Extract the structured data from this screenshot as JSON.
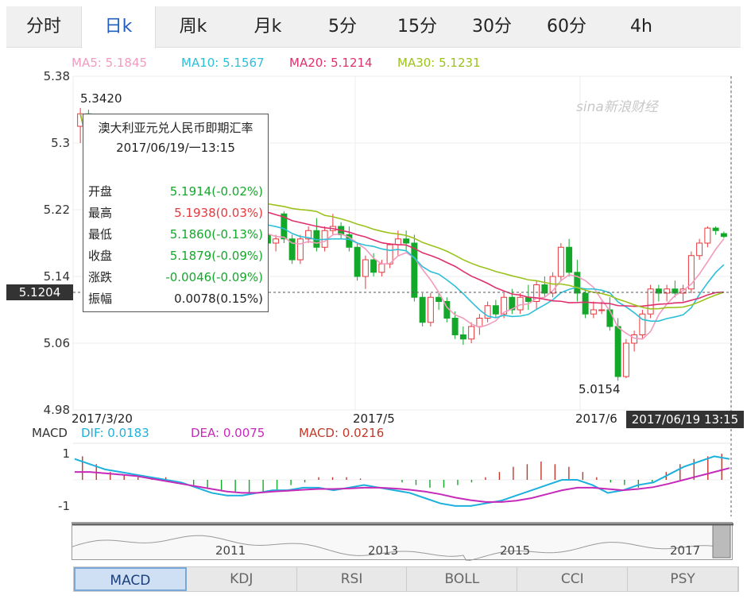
{
  "tabs": [
    "分时",
    "日k",
    "周k",
    "月k",
    "5分",
    "15分",
    "30分",
    "60分",
    "4h"
  ],
  "active_tab": 1,
  "ma_legend": {
    "ma5": "MA5: 5.1845",
    "ma10": "MA10: 5.1567",
    "ma20": "MA20: 5.1214",
    "ma30": "MA30: 5.1231"
  },
  "colors": {
    "up": "#e8383d",
    "down": "#14a82a",
    "ma5": "#f29bbf",
    "ma10": "#2ebfd8",
    "ma20": "#e0306e",
    "ma30": "#9bc21c",
    "dif": "#1cb0dd",
    "dea": "#c52ab9",
    "macd_bar": "#c0392b"
  },
  "watermark": "sina新浪财经",
  "price_axis_ticks": [
    "5.38",
    "5.3",
    "5.22",
    "5.14",
    "5.06",
    "4.98"
  ],
  "date_labels": [
    "2017/3/20",
    "2017/5",
    "2017/6"
  ],
  "annotations": {
    "high": "5.3420",
    "low": "5.0154"
  },
  "crosshair": {
    "price_label": "5.1204",
    "date_label": "2017/06/19 13:15"
  },
  "tooltip": {
    "title": "澳大利亚元兑人民币即期汇率",
    "date": "2017/06/19/一13:15",
    "rows": [
      {
        "label": "开盘",
        "value": "5.1914(-0.02%)",
        "color": "down"
      },
      {
        "label": "最高",
        "value": "5.1938(0.03%)",
        "color": "up"
      },
      {
        "label": "最低",
        "value": "5.1860(-0.13%)",
        "color": "down"
      },
      {
        "label": "收盘",
        "value": "5.1879(-0.09%)",
        "color": "down"
      },
      {
        "label": "涨跌",
        "value": "-0.0046(-0.09%)",
        "color": "down"
      },
      {
        "label": "振幅",
        "value": "0.0078(0.15%)",
        "color": "neutral"
      }
    ]
  },
  "macd_legend": {
    "name": "MACD",
    "dif": "DIF: 0.0183",
    "dea": "DEA: 0.0075",
    "macd": "MACD: 0.0216"
  },
  "macd_axis_ticks": [
    "1",
    "-1"
  ],
  "navigator_years": [
    "2011",
    "2013",
    "2015",
    "2017"
  ],
  "indicator_tabs": [
    "MACD",
    "KDJ",
    "RSI",
    "BOLL",
    "CCI",
    "PSY"
  ],
  "active_indicator": 0,
  "chart_data": {
    "type": "candlestick",
    "ylim": [
      4.98,
      5.38
    ],
    "candles": [
      [
        5.32,
        5.342,
        5.3,
        5.335
      ],
      [
        5.335,
        5.34,
        5.24,
        5.25
      ],
      [
        5.25,
        5.27,
        5.245,
        5.265
      ],
      [
        5.265,
        5.275,
        5.25,
        5.26
      ],
      [
        5.26,
        5.265,
        5.235,
        5.245
      ],
      [
        5.245,
        5.25,
        5.225,
        5.24
      ],
      [
        5.24,
        5.25,
        5.232,
        5.248
      ],
      [
        5.248,
        5.252,
        5.225,
        5.23
      ],
      [
        5.23,
        5.245,
        5.225,
        5.24
      ],
      [
        5.24,
        5.245,
        5.215,
        5.22
      ],
      [
        5.22,
        5.235,
        5.21,
        5.23
      ],
      [
        5.23,
        5.235,
        5.215,
        5.22
      ],
      [
        5.22,
        5.238,
        5.215,
        5.232
      ],
      [
        5.232,
        5.24,
        5.215,
        5.218
      ],
      [
        5.218,
        5.225,
        5.2,
        5.205
      ],
      [
        5.205,
        5.215,
        5.195,
        5.21
      ],
      [
        5.21,
        5.222,
        5.205,
        5.218
      ],
      [
        5.218,
        5.226,
        5.21,
        5.222
      ],
      [
        5.222,
        5.228,
        5.205,
        5.208
      ],
      [
        5.208,
        5.215,
        5.195,
        5.2
      ],
      [
        5.2,
        5.208,
        5.185,
        5.19
      ],
      [
        5.19,
        5.2,
        5.18,
        5.195
      ],
      [
        5.195,
        5.205,
        5.185,
        5.19
      ],
      [
        5.19,
        5.198,
        5.175,
        5.18
      ],
      [
        5.18,
        5.19,
        5.17,
        5.185
      ],
      [
        5.215,
        5.218,
        5.18,
        5.185
      ],
      [
        5.185,
        5.19,
        5.155,
        5.16
      ],
      [
        5.16,
        5.19,
        5.155,
        5.185
      ],
      [
        5.185,
        5.2,
        5.18,
        5.195
      ],
      [
        5.195,
        5.21,
        5.17,
        5.175
      ],
      [
        5.175,
        5.2,
        5.17,
        5.195
      ],
      [
        5.195,
        5.215,
        5.19,
        5.2
      ],
      [
        5.2,
        5.205,
        5.185,
        5.19
      ],
      [
        5.19,
        5.2,
        5.17,
        5.175
      ],
      [
        5.175,
        5.18,
        5.135,
        5.14
      ],
      [
        5.14,
        5.165,
        5.125,
        5.16
      ],
      [
        5.16,
        5.168,
        5.14,
        5.145
      ],
      [
        5.145,
        5.16,
        5.14,
        5.155
      ],
      [
        5.155,
        5.18,
        5.15,
        5.178
      ],
      [
        5.178,
        5.195,
        5.165,
        5.185
      ],
      [
        5.185,
        5.195,
        5.17,
        5.18
      ],
      [
        5.18,
        5.19,
        5.11,
        5.115
      ],
      [
        5.115,
        5.12,
        5.08,
        5.085
      ],
      [
        5.085,
        5.12,
        5.08,
        5.115
      ],
      [
        5.115,
        5.12,
        5.1,
        5.11
      ],
      [
        5.11,
        5.115,
        5.085,
        5.09
      ],
      [
        5.09,
        5.098,
        5.065,
        5.07
      ],
      [
        5.07,
        5.08,
        5.058,
        5.065
      ],
      [
        5.065,
        5.085,
        5.06,
        5.08
      ],
      [
        5.08,
        5.095,
        5.07,
        5.09
      ],
      [
        5.09,
        5.11,
        5.085,
        5.105
      ],
      [
        5.105,
        5.112,
        5.09,
        5.095
      ],
      [
        5.095,
        5.12,
        5.09,
        5.115
      ],
      [
        5.115,
        5.125,
        5.095,
        5.1
      ],
      [
        5.1,
        5.12,
        5.095,
        5.115
      ],
      [
        5.115,
        5.13,
        5.1,
        5.11
      ],
      [
        5.11,
        5.135,
        5.1,
        5.13
      ],
      [
        5.13,
        5.14,
        5.115,
        5.12
      ],
      [
        5.12,
        5.145,
        5.115,
        5.14
      ],
      [
        5.14,
        5.18,
        5.135,
        5.175
      ],
      [
        5.175,
        5.185,
        5.14,
        5.145
      ],
      [
        5.145,
        5.16,
        5.11,
        5.12
      ],
      [
        5.12,
        5.125,
        5.09,
        5.095
      ],
      [
        5.095,
        5.11,
        5.09,
        5.1
      ],
      [
        5.1,
        5.11,
        5.095,
        5.1
      ],
      [
        5.1,
        5.115,
        5.075,
        5.08
      ],
      [
        5.08,
        5.09,
        5.015,
        5.02
      ],
      [
        5.02,
        5.065,
        5.018,
        5.06
      ],
      [
        5.06,
        5.075,
        5.05,
        5.07
      ],
      [
        5.07,
        5.1,
        5.065,
        5.095
      ],
      [
        5.095,
        5.13,
        5.09,
        5.125
      ],
      [
        5.125,
        5.13,
        5.11,
        5.12
      ],
      [
        5.12,
        5.13,
        5.11,
        5.125
      ],
      [
        5.125,
        5.135,
        5.115,
        5.12
      ],
      [
        5.12,
        5.13,
        5.11,
        5.125
      ],
      [
        5.125,
        5.17,
        5.12,
        5.165
      ],
      [
        5.165,
        5.185,
        5.16,
        5.18
      ],
      [
        5.18,
        5.2,
        5.175,
        5.198
      ],
      [
        5.198,
        5.2,
        5.19,
        5.195
      ],
      [
        5.1914,
        5.1938,
        5.186,
        5.1879
      ]
    ],
    "macd": {
      "ylim": [
        -1.4,
        1.4
      ],
      "dif": [
        0.8,
        0.6,
        0.4,
        0.3,
        0.2,
        0.1,
        0.0,
        -0.1,
        -0.3,
        -0.5,
        -0.6,
        -0.6,
        -0.5,
        -0.4,
        -0.4,
        -0.3,
        -0.3,
        -0.4,
        -0.3,
        -0.2,
        -0.3,
        -0.4,
        -0.5,
        -0.7,
        -0.9,
        -1.0,
        -1.0,
        -0.9,
        -0.8,
        -0.6,
        -0.4,
        -0.2,
        0.0,
        0.0,
        -0.2,
        -0.5,
        -0.4,
        -0.2,
        -0.1,
        0.2,
        0.5,
        0.7,
        0.9,
        0.8
      ],
      "dea": [
        0.3,
        0.3,
        0.25,
        0.2,
        0.15,
        0.05,
        -0.05,
        -0.15,
        -0.25,
        -0.35,
        -0.45,
        -0.5,
        -0.5,
        -0.45,
        -0.42,
        -0.38,
        -0.35,
        -0.35,
        -0.33,
        -0.3,
        -0.3,
        -0.33,
        -0.38,
        -0.45,
        -0.55,
        -0.68,
        -0.78,
        -0.85,
        -0.85,
        -0.8,
        -0.7,
        -0.55,
        -0.4,
        -0.3,
        -0.3,
        -0.35,
        -0.4,
        -0.35,
        -0.28,
        -0.15,
        0.0,
        0.15,
        0.3,
        0.45
      ],
      "bars": [
        0.9,
        0.6,
        0.3,
        0.2,
        0.1,
        0.1,
        0.1,
        0.0,
        -0.2,
        -0.3,
        -0.4,
        -0.5,
        -0.5,
        -0.5,
        -0.4,
        -0.2,
        -0.1,
        0.1,
        0.1,
        0.1,
        0.05,
        0.0,
        0.0,
        -0.1,
        -0.2,
        -0.3,
        -0.3,
        -0.2,
        -0.1,
        0.1,
        0.3,
        0.5,
        0.6,
        0.7,
        0.6,
        0.5,
        0.3,
        0.1,
        -0.1,
        -0.2,
        -0.3,
        -0.1,
        0.3,
        0.6,
        0.8,
        0.9,
        1.0
      ]
    }
  }
}
